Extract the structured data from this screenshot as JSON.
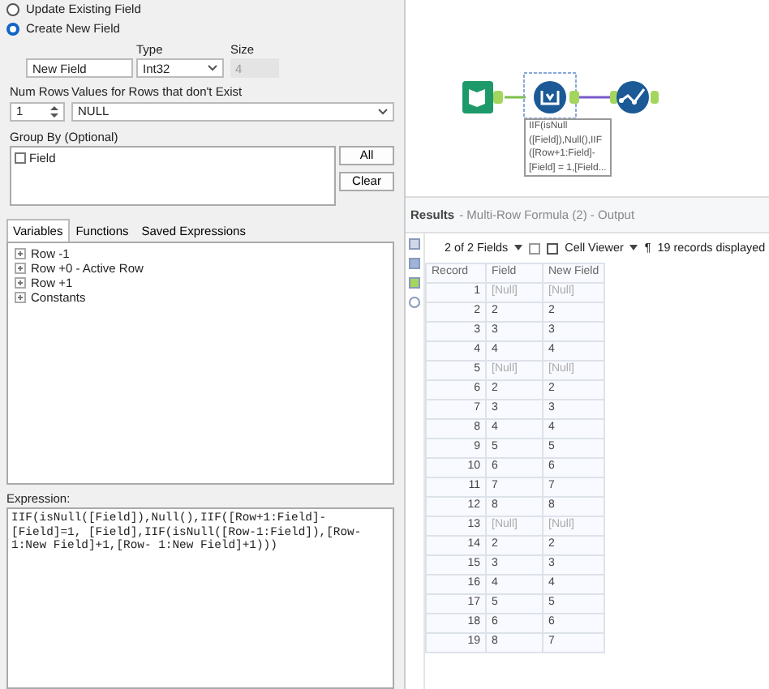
{
  "config": {
    "options": [
      {
        "label": "Update Existing Field",
        "selected": false
      },
      {
        "label": "Create New  Field",
        "selected": true
      }
    ],
    "new_field": {
      "value": "New Field"
    },
    "type": {
      "label": "Type",
      "value": "Int32"
    },
    "size": {
      "label": "Size",
      "value": "4",
      "disabled": true
    },
    "num_rows": {
      "label": "Num Rows",
      "value": "1"
    },
    "missing_rows": {
      "label": "Values for Rows that don't Exist",
      "value": "NULL"
    },
    "group_by": {
      "label": "Group By (Optional)",
      "items": [
        {
          "label": "Field",
          "checked": false
        }
      ],
      "buttons": [
        "All",
        "Clear"
      ]
    },
    "tabs": [
      {
        "label": "Variables",
        "selected": true
      },
      {
        "label": "Functions",
        "selected": false
      },
      {
        "label": "Saved Expressions",
        "selected": false
      }
    ],
    "tree": [
      {
        "label": "Row -1",
        "expanded": false
      },
      {
        "label": "Row +0 - Active Row",
        "expanded": false
      },
      {
        "label": "Row +1",
        "expanded": false
      },
      {
        "label": "Constants",
        "expanded": false
      }
    ],
    "expression": {
      "label": "Expression:",
      "value": "IIF(isNull([Field]),Null(),IIF([Row+1:Field]-[Field]=1, [Field],IIF(isNull([Row-1:Field]),[Row-1:New Field]+1,[Row- 1:New Field]+1)))"
    }
  },
  "canvas": {
    "annotation": [
      "IIF(isNull",
      "([Field]),Null(),IIF",
      "([Row+1:Field]-",
      "[Field] = 1,[Field..."
    ]
  },
  "results": {
    "title": "Results",
    "subtitle": "- Multi-Row Formula (2) - Output",
    "fields": "2 of 2 Fields",
    "viewer": "Cell Viewer",
    "pilcrow": "¶",
    "count": "19 records displayed",
    "columns": [
      "Record",
      "Field",
      "New Field"
    ],
    "rows": [
      [
        "1",
        "[Null]",
        "[Null]"
      ],
      [
        "2",
        "2",
        "2"
      ],
      [
        "3",
        "3",
        "3"
      ],
      [
        "4",
        "4",
        "4"
      ],
      [
        "5",
        "[Null]",
        "[Null]"
      ],
      [
        "6",
        "2",
        "2"
      ],
      [
        "7",
        "3",
        "3"
      ],
      [
        "8",
        "4",
        "4"
      ],
      [
        "9",
        "5",
        "5"
      ],
      [
        "10",
        "6",
        "6"
      ],
      [
        "11",
        "7",
        "7"
      ],
      [
        "12",
        "8",
        "8"
      ],
      [
        "13",
        "[Null]",
        "[Null]"
      ],
      [
        "14",
        "2",
        "2"
      ],
      [
        "15",
        "3",
        "3"
      ],
      [
        "16",
        "4",
        "4"
      ],
      [
        "17",
        "5",
        "5"
      ],
      [
        "18",
        "6",
        "6"
      ],
      [
        "19",
        "8",
        "7"
      ]
    ]
  }
}
